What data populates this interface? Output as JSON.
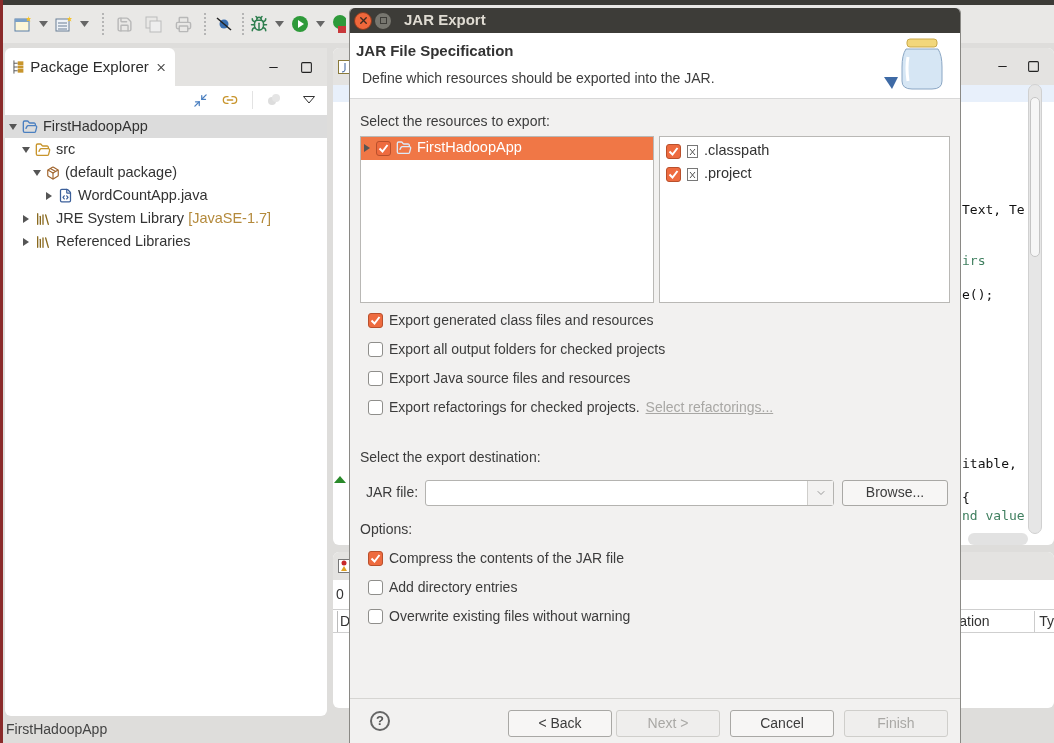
{
  "toolbar": {
    "items": [
      {
        "kind": "new-window",
        "disabled": false
      },
      {
        "kind": "caret",
        "disabled": false
      },
      {
        "kind": "new-class",
        "disabled": false
      },
      {
        "kind": "caret",
        "disabled": false
      },
      {
        "kind": "separator"
      },
      {
        "kind": "save",
        "disabled": true
      },
      {
        "kind": "save-all",
        "disabled": true
      },
      {
        "kind": "print",
        "disabled": true
      },
      {
        "kind": "separator"
      },
      {
        "kind": "skip",
        "disabled": false
      },
      {
        "kind": "separator"
      },
      {
        "kind": "debug",
        "disabled": false
      },
      {
        "kind": "caret",
        "disabled": false
      },
      {
        "kind": "run",
        "disabled": false
      },
      {
        "kind": "caret",
        "disabled": false
      },
      {
        "kind": "run-ext",
        "disabled": false
      }
    ]
  },
  "explorer": {
    "tab": "Package Explorer",
    "tree": [
      {
        "label": "FirstHadoopApp",
        "kind": "project",
        "expanded": true,
        "selected": true,
        "children": [
          {
            "label": "src",
            "kind": "source-folder",
            "expanded": true,
            "selected": false,
            "children": [
              {
                "label": "(default package)",
                "kind": "package",
                "expanded": true,
                "selected": false,
                "children": [
                  {
                    "label": "WordCountApp.java",
                    "kind": "java-file",
                    "expanded": false,
                    "selected": false
                  }
                ]
              }
            ]
          },
          {
            "label": "JRE System Library",
            "decoration": "[JavaSE-1.7]",
            "kind": "library",
            "expanded": false,
            "selected": false
          },
          {
            "label": "Referenced Libraries",
            "kind": "library",
            "expanded": false,
            "selected": false
          }
        ]
      }
    ]
  },
  "editor": {
    "code_lines": [
      {
        "text": "Text, Te",
        "kind": "code"
      },
      {
        "text": "irs",
        "kind": "comment"
      },
      {
        "text": "e();",
        "kind": "code"
      },
      {
        "text": "itable,",
        "kind": "code"
      },
      {
        "text": "{",
        "kind": "code"
      },
      {
        "text": "nd value",
        "kind": "comment"
      }
    ]
  },
  "bottom_panel": {
    "count": "0",
    "columns": [
      "D",
      "ation",
      "Ty"
    ]
  },
  "status_bar": "FirstHadoopApp",
  "dialog": {
    "title": "JAR Export",
    "header_title": "JAR File Specification",
    "description": "Define which resources should be exported into the JAR.",
    "resources_label": "Select the resources to export:",
    "resource_tree": [
      {
        "label": "FirstHadoopApp",
        "checked": true,
        "selected": true,
        "expanded": false
      }
    ],
    "resource_files": [
      {
        "label": ".classpath",
        "checked": true
      },
      {
        "label": ".project",
        "checked": true
      }
    ],
    "export_options": [
      {
        "label": "Export generated class files and resources",
        "checked": true
      },
      {
        "label": "Export all output folders for checked projects",
        "checked": false
      },
      {
        "label": "Export Java source files and resources",
        "checked": false
      },
      {
        "label": "Export refactorings for checked projects.",
        "checked": false
      }
    ],
    "refactorings_link": {
      "text": "Select refactorings...",
      "disabled": true
    },
    "help": "?",
    "destination_label": "Select the export destination:",
    "jar_file_label": "JAR file:",
    "browse": "Browse...",
    "options_label": "Options:",
    "options": [
      {
        "label": "Compress the contents of the JAR file",
        "checked": true
      },
      {
        "label": "Add directory entries",
        "checked": false
      },
      {
        "label": "Overwrite existing files without warning",
        "checked": false
      }
    ],
    "buttons": [
      {
        "label": "< Back",
        "disabled": false
      },
      {
        "label": "Next >",
        "disabled": true
      },
      {
        "label": "Cancel",
        "disabled": false
      },
      {
        "label": "Finish",
        "disabled": true
      }
    ]
  }
}
